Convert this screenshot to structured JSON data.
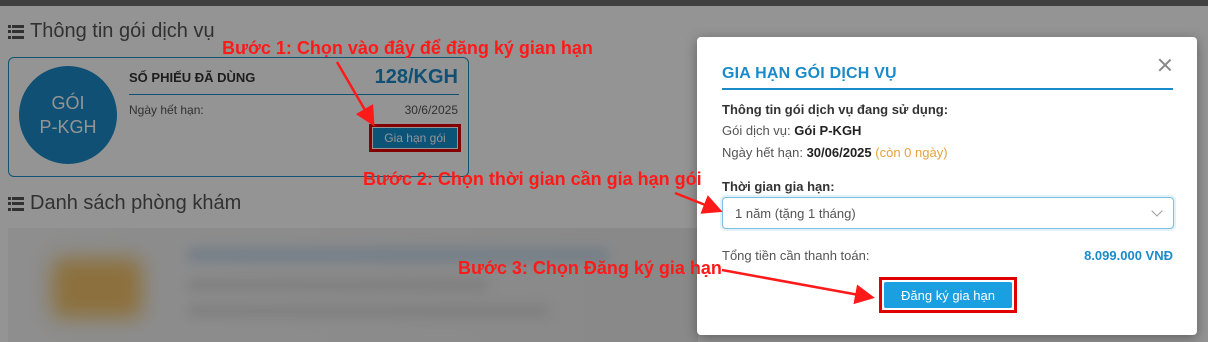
{
  "service_info": {
    "section_title": "Thông tin gói dịch vụ",
    "package_circle_line1": "GÓI",
    "package_circle_line2": "P-KGH",
    "used_label": "SỐ PHIẾU ĐÃ DÙNG",
    "used_value": "128/KGH",
    "expiry_label": "Ngày hết hạn:",
    "expiry_value": "30/6/2025",
    "renew_button": "Gia hạn gói"
  },
  "clinic_list": {
    "section_title": "Danh sách phòng khám"
  },
  "modal": {
    "title": "GIA HẠN GÓI DỊCH VỤ",
    "info_heading": "Thông tin gói dịch vụ đang sử dụng:",
    "package_label": "Gói dịch vụ:",
    "package_value": "Gói P-KGH",
    "expiry_label": "Ngày hết hạn:",
    "expiry_value": "30/06/2025",
    "remaining": "(còn 0 ngày)",
    "period_label": "Thời gian gia hạn:",
    "period_selected": "1 năm (tặng 1 tháng)",
    "total_label": "Tổng tiền cần thanh toán:",
    "total_value": "8.099.000 VNĐ",
    "submit_button": "Đăng ký gia hạn"
  },
  "annotations": {
    "step1": "Bước 1: Chọn vào đây để đăng ký gian hạn",
    "step2": "Bước 2: Chọn thời gian cần gia hạn gói",
    "step3": "Bước 3: Chọn Đăng ký gia hạn"
  },
  "colors": {
    "accent": "#1a8bc9",
    "annotation_red": "#ff1a1a",
    "warning": "#e6a23c"
  },
  "icons": [
    "list-icon",
    "close-icon",
    "chevron-down-icon",
    "arrow-icon"
  ]
}
